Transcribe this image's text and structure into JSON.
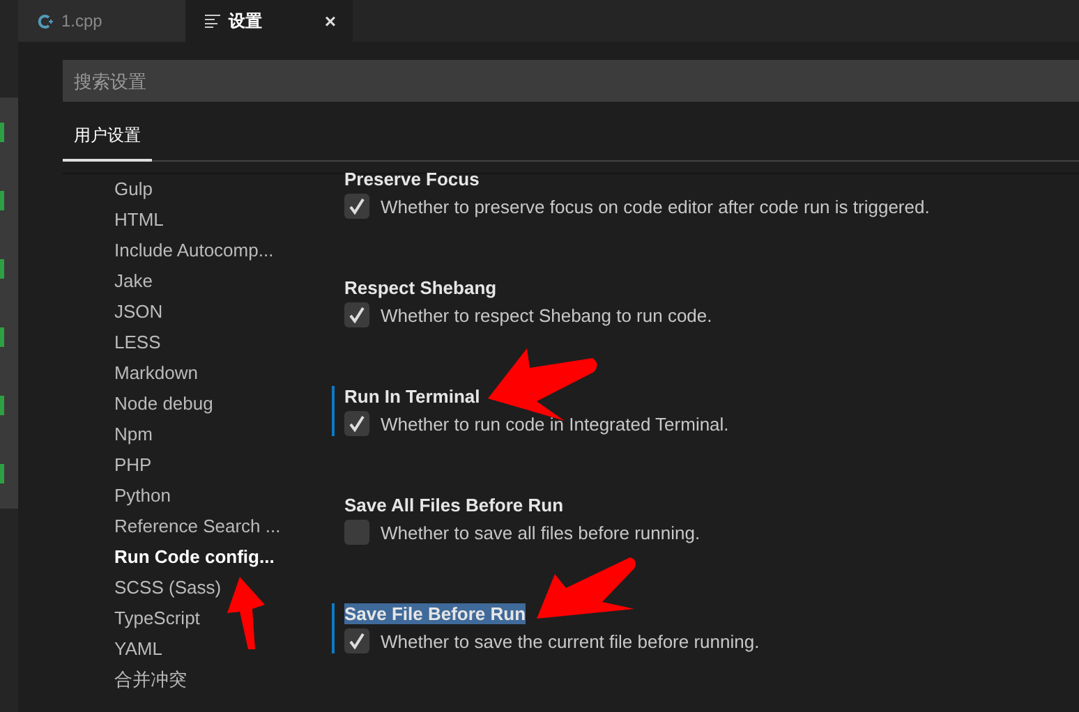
{
  "tabs": [
    {
      "label": "1.cpp",
      "selected": false
    },
    {
      "label": "设置",
      "selected": true,
      "close": "×"
    }
  ],
  "search": {
    "placeholder": "搜索设置"
  },
  "scope_tabs": [
    {
      "label": "用户设置",
      "selected": true
    }
  ],
  "toc": [
    {
      "label": "Gulp",
      "selected": false
    },
    {
      "label": "HTML",
      "selected": false
    },
    {
      "label": "Include Autocomp...",
      "selected": false
    },
    {
      "label": "Jake",
      "selected": false
    },
    {
      "label": "JSON",
      "selected": false
    },
    {
      "label": "LESS",
      "selected": false
    },
    {
      "label": "Markdown",
      "selected": false
    },
    {
      "label": "Node debug",
      "selected": false
    },
    {
      "label": "Npm",
      "selected": false
    },
    {
      "label": "PHP",
      "selected": false
    },
    {
      "label": "Python",
      "selected": false
    },
    {
      "label": "Reference Search ...",
      "selected": false
    },
    {
      "label": "Run Code config...",
      "selected": true
    },
    {
      "label": "SCSS (Sass)",
      "selected": false
    },
    {
      "label": "TypeScript",
      "selected": false
    },
    {
      "label": "YAML",
      "selected": false
    },
    {
      "label": "合并冲突",
      "selected": false
    }
  ],
  "settings": [
    {
      "kind": "checkbox",
      "title": "Preserve Focus",
      "description": "Whether to preserve focus on code editor after code run is triggered.",
      "checked": true,
      "modified": false,
      "highlighted": false
    },
    {
      "kind": "checkbox",
      "title": "Respect Shebang",
      "description": "Whether to respect Shebang to run code.",
      "checked": true,
      "modified": false,
      "highlighted": false
    },
    {
      "kind": "checkbox",
      "title": "Run In Terminal",
      "description": "Whether to run code in Integrated Terminal.",
      "checked": true,
      "modified": true,
      "highlighted": false
    },
    {
      "kind": "checkbox",
      "title": "Save All Files Before Run",
      "description": "Whether to save all files before running.",
      "checked": false,
      "modified": false,
      "highlighted": false
    },
    {
      "kind": "checkbox",
      "title": "Save File Before Run",
      "description": "Whether to save the current file before running.",
      "checked": true,
      "modified": true,
      "highlighted": true
    }
  ]
}
